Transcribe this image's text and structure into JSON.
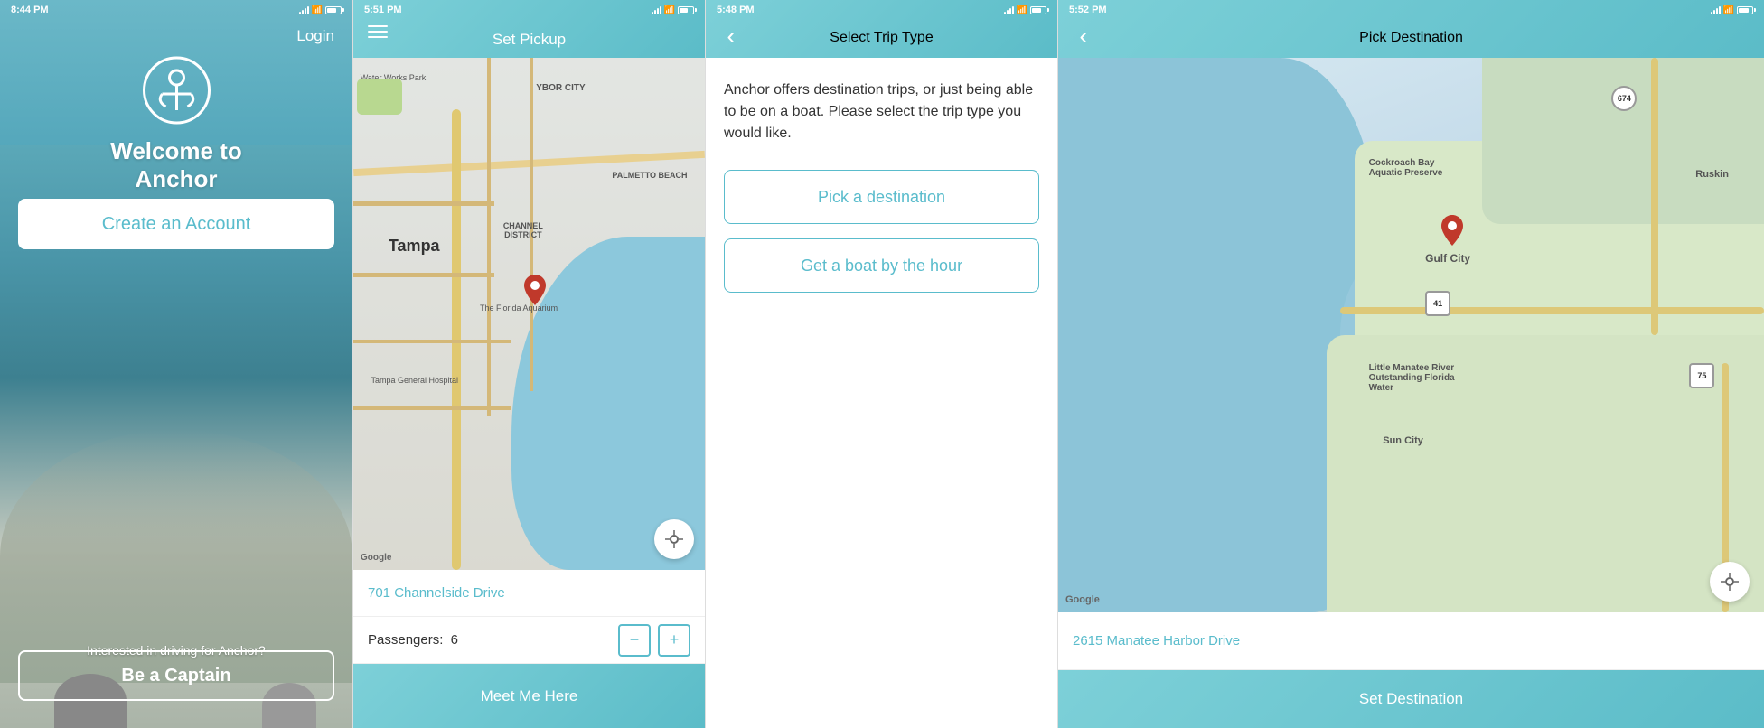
{
  "screen1": {
    "status_time": "8:44 PM",
    "login_label": "Login",
    "title": "Welcome to Anchor",
    "create_account_label": "Create an Account",
    "driver_text": "Interested in driving for Anchor?",
    "captain_label": "Be a Captain"
  },
  "screen2": {
    "status_time": "5:51 PM",
    "header_title": "Set Pickup",
    "address_value": "701 Channelside Drive",
    "passengers_label": "Passengers:",
    "passenger_count": "6",
    "decrement_label": "−",
    "increment_label": "+",
    "meet_me_label": "Meet Me Here",
    "map_label1": "Tampa",
    "map_label2": "YBOR CITY",
    "map_label3": "CHANNEL DISTRICT",
    "map_label4": "PALMETTO BEACH",
    "map_label5": "The Florida Aquarium",
    "map_label6": "Tampa General Hospital",
    "map_label7": "Water Works Park"
  },
  "screen3": {
    "status_time": "5:48 PM",
    "header_title": "Select Trip Type",
    "description": "Anchor offers destination trips, or just being able to be on a boat. Please select the trip type you would like.",
    "destination_btn": "Pick a destination",
    "hour_btn": "Get a boat by the hour"
  },
  "screen4": {
    "status_time": "5:52 PM",
    "header_title": "Pick Destination",
    "address_value": "2615 Manatee Harbor Drive",
    "set_destination_label": "Set Destination",
    "map_label1": "Gulf City",
    "map_label2": "Cockroach Bay Aquatic Preserve",
    "map_label3": "Little Manatee River Outstanding Florida Water",
    "map_label4": "Sun City",
    "map_label5": "Ruskin",
    "google_label": "Google"
  },
  "icons": {
    "location_target": "⊕",
    "back_chevron": "‹",
    "hamburger": "≡"
  }
}
